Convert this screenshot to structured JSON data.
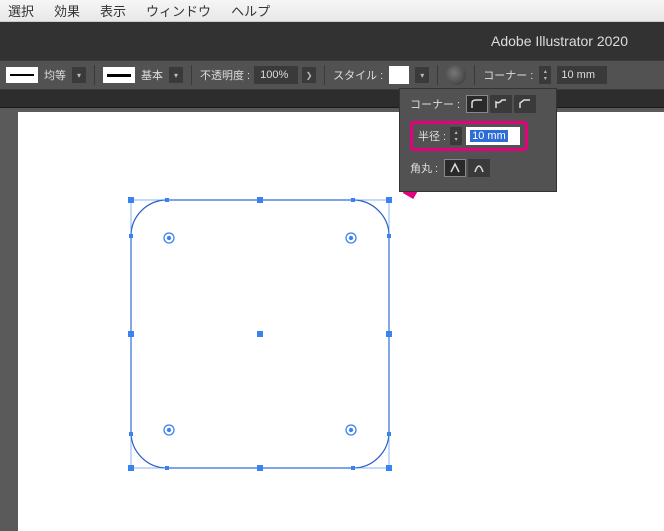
{
  "menubar": {
    "items": [
      "選択",
      "効果",
      "表示",
      "ウィンドウ",
      "ヘルプ"
    ]
  },
  "app_title": "Adobe Illustrator 2020",
  "controlbar": {
    "stroke_uniform": "均等",
    "stroke_basic": "基本",
    "opacity_label": "不透明度 :",
    "opacity_value": "100%",
    "style_label": "スタイル :",
    "corner_label": "コーナー :",
    "corner_value": "10 mm"
  },
  "popup": {
    "corner_label": "コーナー :",
    "radius_label": "半径 :",
    "radius_value": "10 mm",
    "round_label": "角丸 :"
  },
  "chart_data": {
    "type": "diagram",
    "shape": "rounded-rectangle",
    "corner_radius_mm": 10,
    "selected": true
  }
}
